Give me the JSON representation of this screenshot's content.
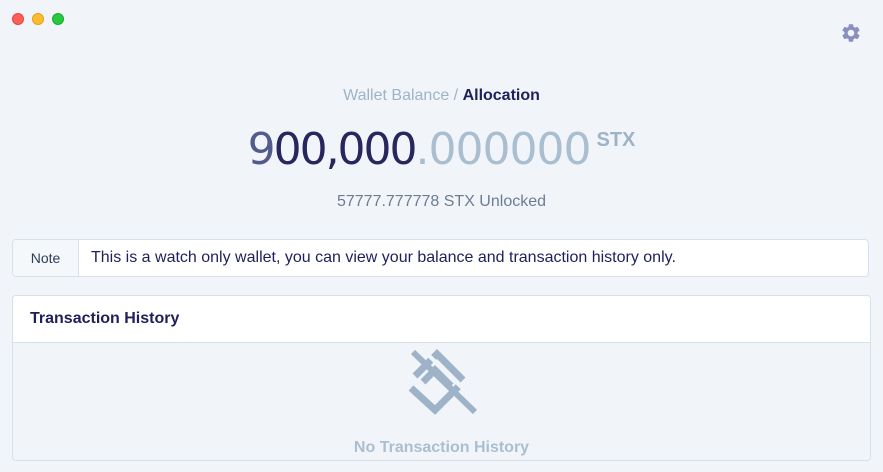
{
  "window": {
    "controls": [
      "close",
      "minimize",
      "zoom"
    ]
  },
  "header": {
    "settings_icon": "gear-icon"
  },
  "breadcrumb": {
    "parent": "Wallet Balance",
    "separator": " / ",
    "current": "Allocation"
  },
  "balance": {
    "integer_first": "9",
    "integer_rest": "00,000",
    "decimal": ".000000",
    "unit": "STX",
    "unlocked": "57777.777778 STX Unlocked"
  },
  "note": {
    "tag": "Note",
    "text": "This is a watch only wallet, you can view your balance and transaction history only."
  },
  "history": {
    "title": "Transaction History",
    "empty_icon": "no-transactions-icon",
    "empty_label": "No Transaction History"
  },
  "colors": {
    "background": "#f1f5f9",
    "primary_text": "#1f1f5c",
    "muted_text": "#a9bfd1",
    "icon": "#8b8fbf"
  }
}
